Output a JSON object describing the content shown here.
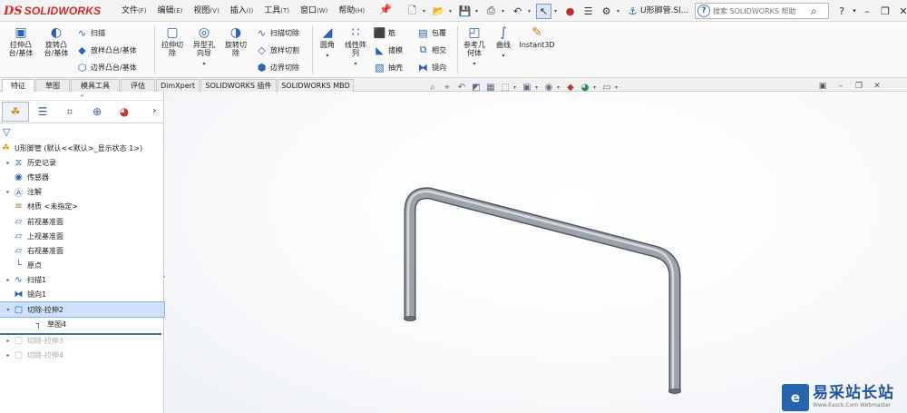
{
  "app": {
    "brand_ds": "DS",
    "brand_name": "SOLIDWORKS"
  },
  "menu": [
    {
      "label": "文件",
      "key": "(F)"
    },
    {
      "label": "编辑",
      "key": "(E)"
    },
    {
      "label": "视图",
      "key": "(V)"
    },
    {
      "label": "插入",
      "key": "(I)"
    },
    {
      "label": "工具",
      "key": "(T)"
    },
    {
      "label": "窗口",
      "key": "(W)"
    },
    {
      "label": "帮助",
      "key": "(H)"
    }
  ],
  "document_title": "U形脚管.Sl...",
  "help_search": {
    "placeholder": "搜索 SOLIDWORKS 帮助"
  },
  "command_manager": {
    "extrude_boss": "拉伸凸\n台/基体",
    "revolve_boss": "旋转凸\n台/基体",
    "sweep": "扫描",
    "loft_boss": "放样凸台/基体",
    "boundary_boss": "边界凸台/基体",
    "extrude_cut": "拉伸切\n除",
    "hole_wizard": "异型孔\n向导",
    "revolve_cut": "旋转切\n除",
    "swept_cut": "扫描切除",
    "lofted_cut": "放样切割",
    "boundary_cut": "边界切除",
    "fillet": "圆角",
    "linear_pattern": "线性阵\n列",
    "rib": "筋",
    "draft": "拔模",
    "shell": "抽壳",
    "wrap": "包覆",
    "intersect": "相交",
    "mirror": "镜向",
    "reference_geometry": "参考几\n何体",
    "curves": "曲线",
    "instant3d": "Instant3D"
  },
  "tabs": [
    "特征",
    "草图",
    "模具工具",
    "评估",
    "DimXpert",
    "SOLIDWORKS 插件",
    "SOLIDWORKS MBD"
  ],
  "tree": {
    "root": "U形脚管 (默认<<默认>_显示状态 1>)",
    "items": [
      {
        "label": "历史记录",
        "icon": "history-icon"
      },
      {
        "label": "传感器",
        "icon": "sensor-icon"
      },
      {
        "label": "注解",
        "icon": "annotation-icon"
      },
      {
        "label": "材质 <未指定>",
        "icon": "material-icon"
      },
      {
        "label": "前视基准面",
        "icon": "plane-icon"
      },
      {
        "label": "上视基准面",
        "icon": "plane-icon"
      },
      {
        "label": "右视基准面",
        "icon": "plane-icon"
      },
      {
        "label": "原点",
        "icon": "origin-icon"
      },
      {
        "label": "扫描1",
        "icon": "sweep-icon"
      },
      {
        "label": "镜向1",
        "icon": "mirror-icon"
      },
      {
        "label": "切除-拉伸2",
        "icon": "cut-extrude-icon"
      },
      {
        "label": "草图4",
        "icon": "sketch-icon"
      },
      {
        "label": "切除-拉伸3",
        "icon": "cut-extrude-icon"
      },
      {
        "label": "切除-拉伸4",
        "icon": "cut-extrude-icon"
      }
    ]
  },
  "watermark": {
    "cn": "易采站长站",
    "en": "Www.Easck.Com Webmaster"
  },
  "colors": {
    "brand": "#d22a2a",
    "accent": "#2b63b6",
    "selection": "#cfe0fb",
    "tube": "#8a8f96"
  }
}
